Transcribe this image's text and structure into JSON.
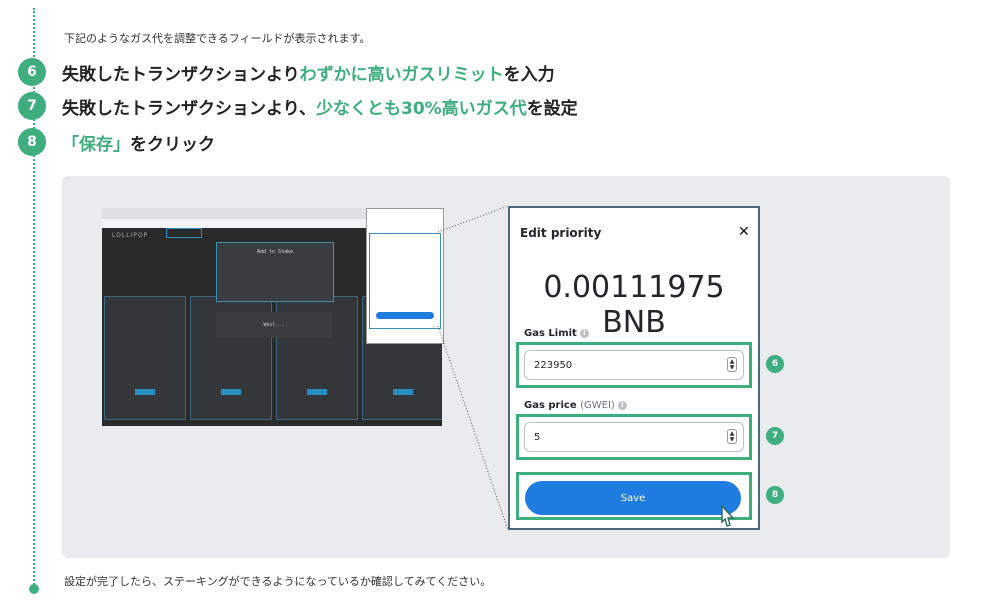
{
  "intro_text": "下記のようなガス代を調整できるフィールドが表示されます。",
  "steps": [
    {
      "number": "6",
      "parts": [
        "失敗したトランザクションより",
        "わずかに高いガスリミット",
        "を入力"
      ]
    },
    {
      "number": "7",
      "parts": [
        "失敗したトランザクションより、",
        "少なくとも30%高いガス代",
        "を設定"
      ]
    },
    {
      "number": "8",
      "parts": [
        "",
        "「保存」",
        "をクリック"
      ]
    }
  ],
  "dialog": {
    "title": "Edit priority",
    "close_icon": "close-icon",
    "amount": "0.00111975 BNB",
    "gas_limit_label": "Gas Limit",
    "gas_limit_value": "223950",
    "gas_price_label": "Gas price",
    "gas_price_unit": "(GWEI)",
    "gas_price_value": "5",
    "save_label": "Save"
  },
  "badges": [
    "6",
    "7",
    "8"
  ],
  "thumbnail": {
    "logo": "LOLLIPOP",
    "modal_title": "Add to Stake",
    "wait_text": "Wait..."
  },
  "outro_text": "設定が完了したら、ステーキングができるようになっているか確認してみてください。",
  "colors": {
    "accent": "#3fae7e",
    "button": "#1f7ce0",
    "panel": "#e9ebed"
  }
}
